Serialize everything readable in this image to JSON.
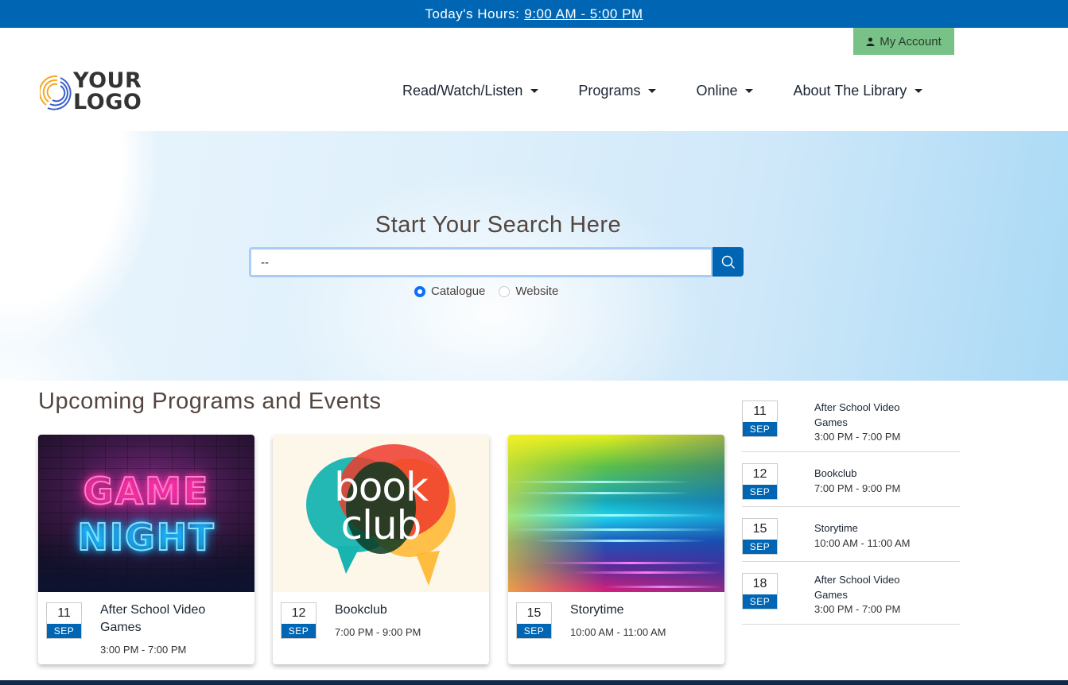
{
  "topbar": {
    "label": "Today's Hours:",
    "hours": "9:00 AM - 5:00 PM"
  },
  "account": {
    "label": "My Account",
    "icon": "user-icon"
  },
  "logo": {
    "line1": "YOUR",
    "line2": "LOGO"
  },
  "nav": {
    "items": [
      {
        "label": "Read/Watch/Listen"
      },
      {
        "label": "Programs"
      },
      {
        "label": "Online"
      },
      {
        "label": "About The Library"
      }
    ]
  },
  "hero": {
    "title": "Start Your Search Here",
    "search_value": "--",
    "search_icon": "search-icon",
    "radio_options": [
      {
        "label": "Catalogue",
        "checked": true
      },
      {
        "label": "Website",
        "checked": false
      }
    ]
  },
  "events": {
    "title": "Upcoming Programs and Events",
    "cards": [
      {
        "day": "11",
        "month": "SEP",
        "title": "After School Video Games",
        "time": "3:00 PM - 7:00 PM",
        "image_text_1": "GAME",
        "image_text_2": "NIGHT"
      },
      {
        "day": "12",
        "month": "SEP",
        "title": "Bookclub",
        "time": "7:00 PM - 9:00 PM",
        "image_text_1": "book",
        "image_text_2": "club"
      },
      {
        "day": "15",
        "month": "SEP",
        "title": "Storytime",
        "time": "10:00 AM - 11:00 AM"
      }
    ],
    "list": [
      {
        "day": "11",
        "month": "SEP",
        "title": "After School Video Games",
        "time": "3:00 PM - 7:00 PM"
      },
      {
        "day": "12",
        "month": "SEP",
        "title": "Bookclub",
        "time": "7:00 PM - 9:00 PM"
      },
      {
        "day": "15",
        "month": "SEP",
        "title": "Storytime",
        "time": "10:00 AM - 11:00 AM"
      },
      {
        "day": "18",
        "month": "SEP",
        "title": "After School Video Games",
        "time": "3:00 PM - 7:00 PM"
      }
    ]
  },
  "colors": {
    "brand_blue": "#0066b3",
    "account_green": "#78c187",
    "heading_brown": "#54463f",
    "footer_navy": "#13284a"
  }
}
